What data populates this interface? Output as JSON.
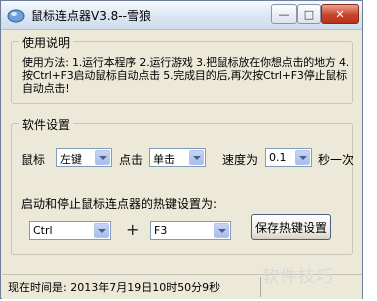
{
  "window": {
    "title": "鼠标连点器V3.8--雪狼",
    "minimize_glyph": "—",
    "maximize_glyph": "□",
    "close_glyph": "✕"
  },
  "usage_group": {
    "title": "使用说明",
    "text": "使用方法: 1.运行本程序 2.运行游戏 3.把鼠标放在你想点击的地方 4.按Ctrl+F3启动鼠标自动点击 5.完成目的后,再次按Ctrl+F3停止鼠标自动点击!"
  },
  "settings_group": {
    "title": "软件设置",
    "mouse_label": "鼠标",
    "mouse_button": "左键",
    "click_label": "点击",
    "click_type": "单击",
    "speed_label": "速度为",
    "speed_value": "0.1",
    "speed_unit": "秒一次",
    "hotkey_label": "启动和停止鼠标连点器的热键设置为:",
    "hotkey_modifier": "Ctrl",
    "plus": "+",
    "hotkey_key": "F3",
    "save_button": "保存热键设置"
  },
  "statusbar": {
    "time_text": "现在时间是: 2013年7月19日10时50分9秒"
  },
  "watermark": "软件技巧"
}
